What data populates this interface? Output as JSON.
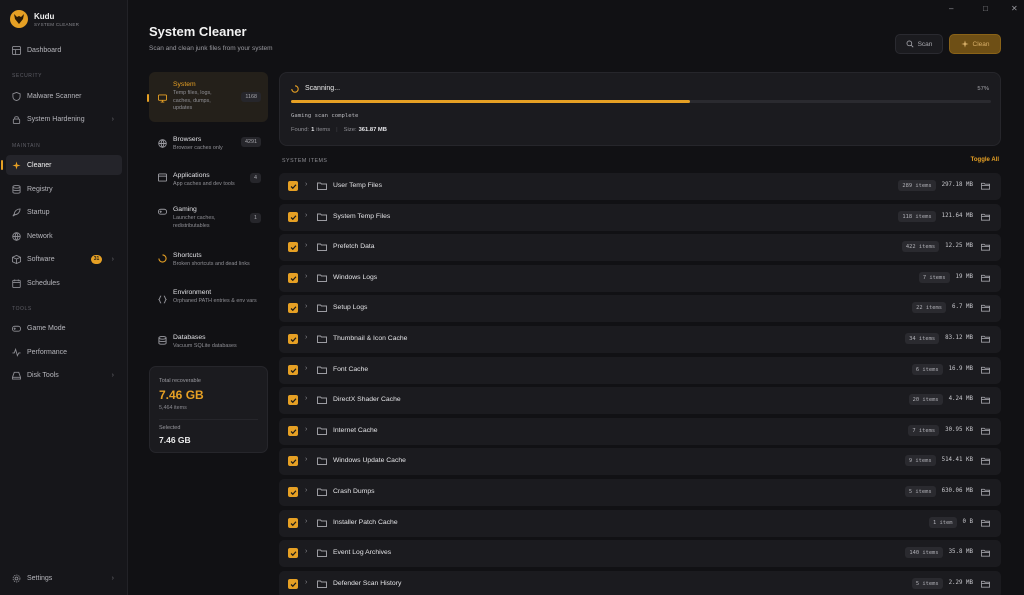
{
  "app": {
    "name": "Kudu",
    "subtitle": "SYSTEM CLEANER"
  },
  "sidebar": {
    "dashboard": "Dashboard",
    "sections": {
      "security": "SECURITY",
      "maintain": "MAINTAIN",
      "tools": "TOOLS"
    },
    "security_items": [
      {
        "label": "Malware Scanner",
        "icon": "shield-icon"
      },
      {
        "label": "System Hardening",
        "icon": "lock-icon"
      }
    ],
    "maintain_items": [
      {
        "label": "Cleaner",
        "icon": "sparkle-icon"
      },
      {
        "label": "Registry",
        "icon": "database-icon"
      },
      {
        "label": "Startup",
        "icon": "rocket-icon"
      },
      {
        "label": "Network",
        "icon": "globe-icon"
      },
      {
        "label": "Software",
        "icon": "package-icon",
        "badge": "31"
      },
      {
        "label": "Schedules",
        "icon": "calendar-icon"
      }
    ],
    "tools_items": [
      {
        "label": "Game Mode",
        "icon": "gamepad-icon"
      },
      {
        "label": "Performance",
        "icon": "activity-icon"
      },
      {
        "label": "Disk Tools",
        "icon": "disk-icon"
      }
    ],
    "settings": "Settings"
  },
  "header": {
    "title": "System Cleaner",
    "subtitle": "Scan and clean junk files from your system",
    "scan_label": "Scan",
    "clean_label": "Clean"
  },
  "categories": [
    {
      "title": "System",
      "desc": "Temp files, logs, caches, dumps, updates",
      "count": "1168",
      "icon": "monitor-icon"
    },
    {
      "title": "Browsers",
      "desc": "Browser caches only",
      "count": "4291",
      "icon": "globe-icon"
    },
    {
      "title": "Applications",
      "desc": "App caches and dev tools",
      "count": "4",
      "icon": "window-icon"
    },
    {
      "title": "Gaming",
      "desc": "Launcher caches, redistributables",
      "count": "1",
      "icon": "gamepad-icon"
    },
    {
      "title": "Shortcuts",
      "desc": "Broken shortcuts and dead links",
      "count": "",
      "icon": "spinner-icon"
    },
    {
      "title": "Environment",
      "desc": "Orphaned PATH entries & env vars",
      "count": "",
      "icon": "braces-icon"
    },
    {
      "title": "Databases",
      "desc": "Vacuum SQLite databases",
      "count": "",
      "icon": "database-icon"
    }
  ],
  "summary": {
    "total_label": "Total recoverable",
    "total_value": "7.46 GB",
    "total_items": "5,464 items",
    "selected_label": "Selected",
    "selected_value": "7.46 GB"
  },
  "scan": {
    "status": "Scanning...",
    "percent_label": "57%",
    "progress": 0.57,
    "log": "Gaming scan complete",
    "found_prefix": "Found:",
    "found_count": "1",
    "found_suffix": "items",
    "size_label": "Size:",
    "size_value": "361.87 MB"
  },
  "list": {
    "header": "SYSTEM ITEMS",
    "toggle_all": "Toggle All",
    "items": [
      {
        "name": "User Temp Files",
        "count": "289 items",
        "size": "297.18 MB"
      },
      {
        "name": "System Temp Files",
        "count": "118 items",
        "size": "121.64 MB"
      },
      {
        "name": "Prefetch Data",
        "count": "422 items",
        "size": "12.25 MB"
      },
      {
        "name": "Windows Logs",
        "count": "7 items",
        "size": "19 MB"
      },
      {
        "name": "Setup Logs",
        "count": "22 items",
        "size": "6.7 MB"
      },
      {
        "name": "Thumbnail & Icon Cache",
        "count": "34 items",
        "size": "83.12 MB"
      },
      {
        "name": "Font Cache",
        "count": "6 items",
        "size": "16.9 MB"
      },
      {
        "name": "DirectX Shader Cache",
        "count": "20 items",
        "size": "4.24 MB"
      },
      {
        "name": "Internet Cache",
        "count": "7 items",
        "size": "30.95 KB"
      },
      {
        "name": "Windows Update Cache",
        "count": "9 items",
        "size": "514.41 KB"
      },
      {
        "name": "Crash Dumps",
        "count": "5 items",
        "size": "630.06 MB"
      },
      {
        "name": "Installer Patch Cache",
        "count": "1 item",
        "size": "0 B"
      },
      {
        "name": "Event Log Archives",
        "count": "140 items",
        "size": "35.8 MB"
      },
      {
        "name": "Defender Scan History",
        "count": "5 items",
        "size": "2.29 MB"
      }
    ]
  },
  "colors": {
    "accent": "#e6a024",
    "background": "#111114",
    "card": "#1b1b1f"
  }
}
